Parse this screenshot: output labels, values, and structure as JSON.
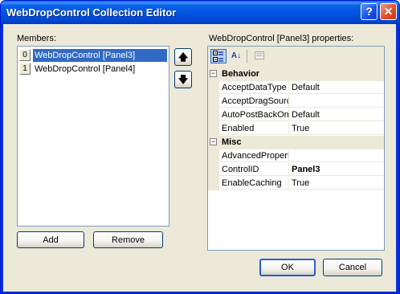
{
  "window": {
    "title": "WebDropControl Collection Editor",
    "help_glyph": "?",
    "close_glyph": "✕"
  },
  "members": {
    "label": "Members:",
    "items": [
      {
        "index": "0",
        "text": "WebDropControl [Panel3]",
        "selected": true
      },
      {
        "index": "1",
        "text": "WebDropControl [Panel4]",
        "selected": false
      }
    ],
    "up_glyph": "🡅",
    "down_glyph": "🡇",
    "add_label": "Add",
    "remove_label": "Remove"
  },
  "properties": {
    "label": "WebDropControl [Panel3] properties:",
    "toolbar": {
      "categorized_icon": "categorized-icon",
      "alphabetical_icon": "alphabetical-icon",
      "alphabetical_glyph": "A↓",
      "pages_icon": "property-pages-icon"
    },
    "categories": [
      {
        "name": "Behavior",
        "toggle": "−",
        "rows": [
          {
            "name": "AcceptDataType",
            "value": "Default"
          },
          {
            "name": "AcceptDragSourc",
            "value": ""
          },
          {
            "name": "AutoPostBackOnD",
            "value": "Default"
          },
          {
            "name": "Enabled",
            "value": "True"
          }
        ]
      },
      {
        "name": "Misc",
        "toggle": "−",
        "rows": [
          {
            "name": "AdvancedPropert",
            "value": ""
          },
          {
            "name": "ControlID",
            "value": "Panel3",
            "bold": true
          },
          {
            "name": "EnableCaching",
            "value": "True"
          }
        ]
      }
    ]
  },
  "footer": {
    "ok_label": "OK",
    "cancel_label": "Cancel"
  },
  "colors": {
    "titlebar": "#0053e0",
    "selection": "#316ac5",
    "dialog_face": "#ece9d8"
  }
}
